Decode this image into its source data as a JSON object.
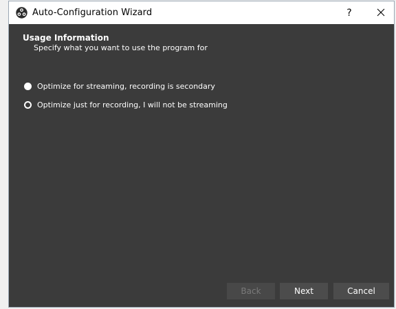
{
  "window": {
    "title": "Auto-Configuration Wizard",
    "help_label": "?",
    "icons": {
      "app": "obs-logo-icon",
      "close": "close-icon"
    }
  },
  "page": {
    "heading": "Usage Information",
    "subheading": "Specify what you want to use the program for"
  },
  "options": [
    {
      "label": "Optimize for streaming, recording is secondary",
      "selected": false
    },
    {
      "label": "Optimize just for recording, I will not be streaming",
      "selected": true
    }
  ],
  "buttons": {
    "back": "Back",
    "next": "Next",
    "cancel": "Cancel"
  },
  "colors": {
    "background": "#3b3b3b",
    "titlebar": "#ffffff",
    "text": "#ffffff",
    "button": "#4c4c4c",
    "button_disabled_text": "#7a7a7a"
  }
}
